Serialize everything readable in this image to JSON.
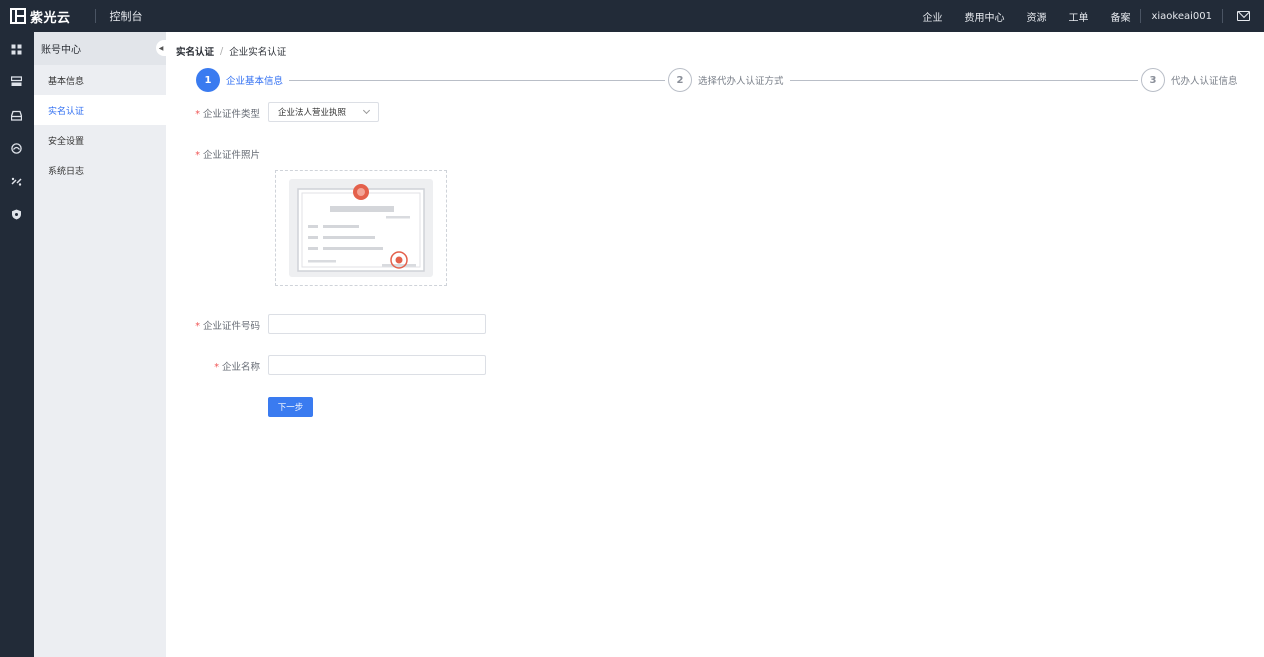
{
  "topbar": {
    "brand": "紫光云",
    "console": "控制台",
    "nav": [
      "企业",
      "费用中心",
      "资源",
      "工单",
      "备案"
    ],
    "username": "xiaokeai001"
  },
  "rail_icons": [
    "dashboard-icon",
    "server-icon",
    "storage-icon",
    "network-icon",
    "exchange-icon",
    "security-icon"
  ],
  "sidebar": {
    "title": "账号中心",
    "items": [
      {
        "label": "基本信息"
      },
      {
        "label": "实名认证",
        "active": true
      },
      {
        "label": "安全设置"
      },
      {
        "label": "系统日志"
      }
    ]
  },
  "breadcrumb": [
    "实名认证",
    "企业实名认证"
  ],
  "steps": [
    {
      "num": "1",
      "label": "企业基本信息",
      "active": true
    },
    {
      "num": "2",
      "label": "选择代办人认证方式",
      "active": false
    },
    {
      "num": "3",
      "label": "代办人认证信息",
      "active": false
    }
  ],
  "form": {
    "cert_type_label": "企业证件类型",
    "cert_type_value": "企业法人营业执照",
    "cert_photo_label": "企业证件照片",
    "cert_number_label": "企业证件号码",
    "cert_number_value": "",
    "company_name_label": "企业名称",
    "company_name_value": "",
    "next_button": "下一步"
  },
  "colors": {
    "topbar_bg": "#222b38",
    "accent": "#3a7bf0",
    "required": "#f05454",
    "seal": "#e4604b"
  }
}
